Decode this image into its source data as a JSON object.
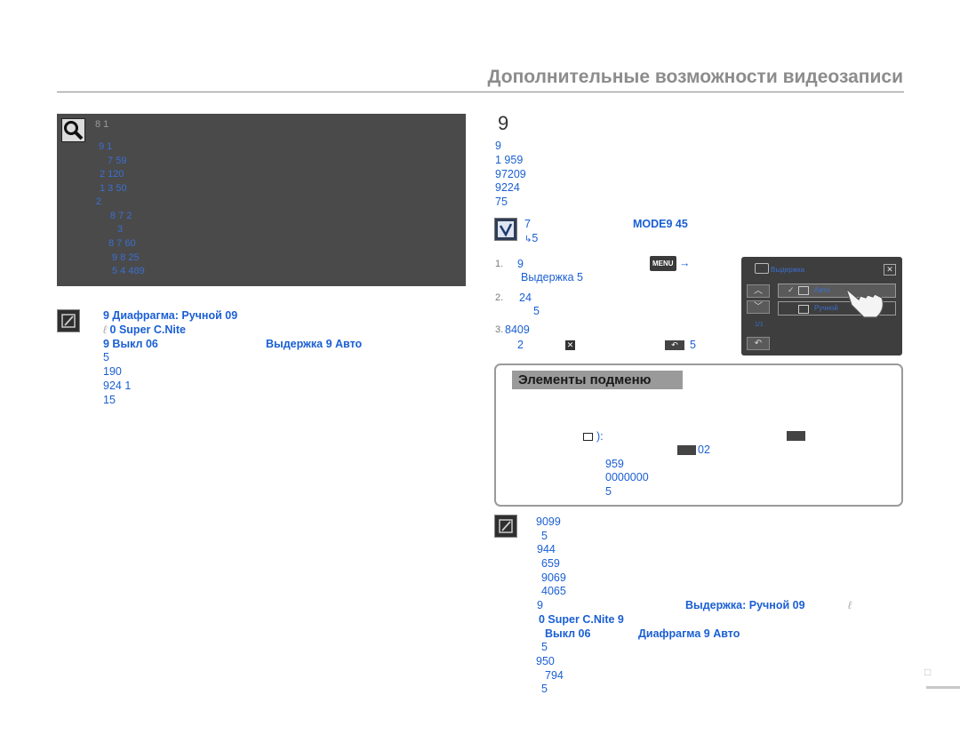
{
  "header": {
    "title": "Дополнительные возможности видеозаписи"
  },
  "left_box": {
    "head": "8 1",
    "lines": [
      "9 1",
      "7 59",
      "2 120",
      "1 3 50",
      "2",
      "8 7 2",
      "3",
      "8 7 60",
      "9 8 25",
      "5 4 489"
    ]
  },
  "left_note": {
    "line1_a": "9 Диафрагма: Ручной 09",
    "line2_a": "0 Super C.Nite",
    "line3_a": "9 Выкл 06",
    "line3_b": "Выдержка 9 Авто",
    "line4": "5",
    "line5": "190",
    "line6": "924 1",
    "line7": "15"
  },
  "section": {
    "number": "9",
    "intro": [
      "9",
      "1 959",
      "97209",
      "9224",
      "75"
    ]
  },
  "check": {
    "line1_a": "7",
    "line1_b": "MODE9 45",
    "line2": "5"
  },
  "steps": {
    "s1_num": "1.",
    "s1_a": "9",
    "s1_menu": "MENU",
    "s1_arrow": "→",
    "s1_b": "Выдержка 5",
    "s2_num": "2.",
    "s2_a": "24",
    "s2_b": "5",
    "s3_num": "3.",
    "s3_a": "8409",
    "s3_b": "2",
    "s3_c": "5"
  },
  "panel": {
    "title": "Выдержка",
    "opt1": "Авто",
    "opt2": "Ручной",
    "page": "1/1"
  },
  "submenu": {
    "heading": "Элементы подменю",
    "colon": "):",
    "num_02": "02",
    "l1": "959",
    "l2": "0000000",
    "l3": "5"
  },
  "right_note": {
    "lines": [
      "9099",
      "5",
      "944",
      "659",
      "9069",
      "4065"
    ],
    "l7_a": "9",
    "l7_b": "Выдержка: Ручной 09",
    "l8": "0 Super C.Nite 9",
    "l9_a": "Выкл 06",
    "l9_b": "Диафрагма 9 Авто",
    "tail": [
      "5",
      "950",
      "794",
      "5"
    ]
  },
  "footer": {
    "page_glyph": "□"
  }
}
